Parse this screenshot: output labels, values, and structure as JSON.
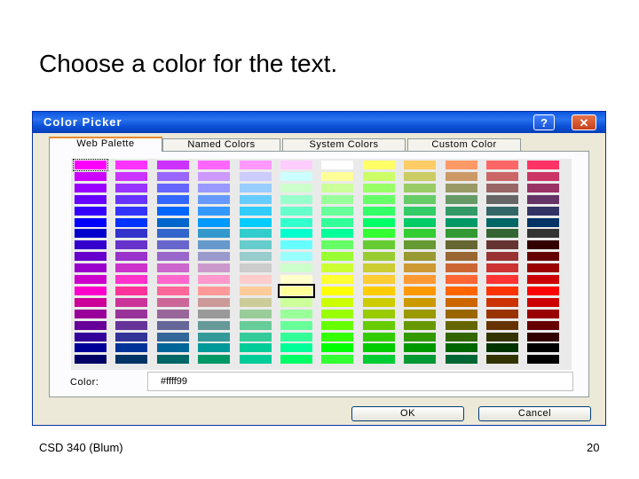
{
  "slide": {
    "title": "Choose a color for the text.",
    "footer_left": "CSD 340 (Blum)",
    "page_number": "20"
  },
  "dialog": {
    "title": "Color Picker",
    "help_label": "?",
    "close_label": "✕",
    "tabs": [
      "Web Palette",
      "Named Colors",
      "System Colors",
      "Custom Color"
    ],
    "active_tab": "Web Palette",
    "color_label": "Color:",
    "color_value": "#ffff99",
    "ok_label": "OK",
    "cancel_label": "Cancel"
  },
  "palette": {
    "columns": 12,
    "rows": 18,
    "selected_color": "#ffff99",
    "focused_color": "#ff00ff",
    "colors": [
      [
        "#ff00ff",
        "#ff33ff",
        "#cc33ff",
        "#ff66ff",
        "#ff99ff",
        "#ffccff",
        "#ffffff",
        "#ffff66",
        "#ffcc66",
        "#ff9966",
        "#ff6666",
        "#ff3366",
        "#ff0066"
      ],
      [
        "#cc00ff",
        "#cc33ff",
        "#9966ff",
        "#cc99ff",
        "#ccccff",
        "#ccffff",
        "#ffff99",
        "#ccff66",
        "#cccc66",
        "#cc9966",
        "#cc6666",
        "#cc3366",
        "#cc0066"
      ],
      [
        "#9900ff",
        "#9933ff",
        "#6666ff",
        "#9999ff",
        "#99ccff",
        "#ccffcc",
        "#ccff99",
        "#99ff66",
        "#99cc66",
        "#999966",
        "#996666",
        "#993366",
        "#990066"
      ],
      [
        "#6600ff",
        "#6633ff",
        "#3366ff",
        "#6699ff",
        "#66ccff",
        "#99ffcc",
        "#99ff99",
        "#66ff66",
        "#66cc66",
        "#669966",
        "#666666",
        "#663366",
        "#660066"
      ],
      [
        "#3300ff",
        "#3333ff",
        "#0066ff",
        "#3399ff",
        "#33ccff",
        "#66ffcc",
        "#66ff99",
        "#33ff66",
        "#33cc66",
        "#339966",
        "#336666",
        "#333366",
        "#330066"
      ],
      [
        "#0000ff",
        "#0033ff",
        "#0066cc",
        "#0099ff",
        "#00ccff",
        "#33ffcc",
        "#33ff99",
        "#00ff66",
        "#00cc66",
        "#009966",
        "#006666",
        "#003366",
        "#000066"
      ],
      [
        "#0000cc",
        "#3333cc",
        "#3366cc",
        "#3399cc",
        "#33cccc",
        "#00ffcc",
        "#00ff99",
        "#33ff33",
        "#33cc33",
        "#339933",
        "#336633",
        "#333333",
        "#330033"
      ],
      [
        "#3300cc",
        "#6633cc",
        "#6666cc",
        "#6699cc",
        "#66cccc",
        "#66ffff",
        "#66ff66",
        "#66cc33",
        "#669933",
        "#666633",
        "#663333",
        "#330000"
      ],
      [
        "#6600cc",
        "#9933cc",
        "#9966cc",
        "#9999cc",
        "#99cccc",
        "#99ffff",
        "#99ff33",
        "#99cc33",
        "#999933",
        "#996633",
        "#993333",
        "#660000"
      ],
      [
        "#9900cc",
        "#cc33cc",
        "#cc66cc",
        "#cc99cc",
        "#cccccc",
        "#ccffcc",
        "#ccff33",
        "#cccc33",
        "#cc9933",
        "#cc6633",
        "#cc3333",
        "#990000"
      ],
      [
        "#cc00cc",
        "#ff33cc",
        "#ff66cc",
        "#ff99cc",
        "#ffcccc",
        "#ffffcc",
        "#ffff33",
        "#ffcc33",
        "#ff9933",
        "#ff6633",
        "#ff3333",
        "#cc0000"
      ],
      [
        "#ff00cc",
        "#ff3399",
        "#ff6699",
        "#ff9999",
        "#ffcc99",
        "#ffff99",
        "#ffff00",
        "#ffcc00",
        "#ff9900",
        "#ff6600",
        "#ff3300",
        "#ff0000"
      ],
      [
        "#cc0099",
        "#cc3399",
        "#cc6699",
        "#cc9999",
        "#cccc99",
        "#ccff99",
        "#ccff00",
        "#cccc00",
        "#cc9900",
        "#cc6600",
        "#cc3300",
        "#cc0000"
      ],
      [
        "#990099",
        "#993399",
        "#996699",
        "#999999",
        "#99cc99",
        "#99ff99",
        "#99ff00",
        "#99cc00",
        "#999900",
        "#996600",
        "#993300",
        "#990000"
      ],
      [
        "#660099",
        "#663399",
        "#666699",
        "#669999",
        "#66cc99",
        "#66ff99",
        "#66ff00",
        "#66cc00",
        "#669900",
        "#666600",
        "#663300",
        "#660000"
      ],
      [
        "#330099",
        "#333399",
        "#336699",
        "#339999",
        "#33cc99",
        "#33ff99",
        "#33ff00",
        "#33cc00",
        "#339900",
        "#336600",
        "#333300",
        "#330000"
      ],
      [
        "#000099",
        "#003399",
        "#006699",
        "#009999",
        "#00cc99",
        "#00ff99",
        "#00ff00",
        "#00cc00",
        "#009900",
        "#006600",
        "#003300",
        "#000000"
      ],
      [
        "#000066",
        "#003366",
        "#006666",
        "#009966",
        "#00cc99",
        "#00ff66",
        "#33ff33",
        "#00cc33",
        "#009933",
        "#006633",
        "#333300",
        "#000000"
      ]
    ]
  }
}
